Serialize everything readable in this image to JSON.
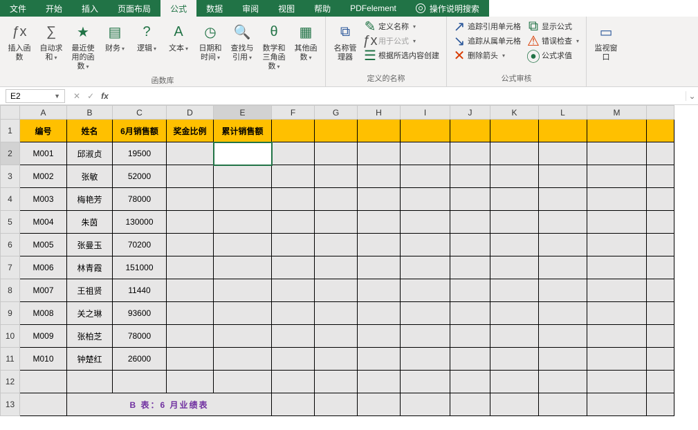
{
  "tabs": {
    "file": "文件",
    "home": "开始",
    "insert": "插入",
    "layout": "页面布局",
    "formulas": "公式",
    "data": "数据",
    "review": "审阅",
    "view": "视图",
    "help": "帮助",
    "pdf": "PDFelement",
    "tell": "操作说明搜索"
  },
  "ribbon": {
    "insert_fn": "插入函数",
    "autosum": "自动求和",
    "recent": "最近使用的函数",
    "financial": "财务",
    "logical": "逻辑",
    "text": "文本",
    "datetime": "日期和时间",
    "lookup": "查找与引用",
    "math": "数学和三角函数",
    "more": "其他函数",
    "lib_label": "函数库",
    "name_mgr": "名称管理器",
    "def_name": "定义名称",
    "use_formula": "用于公式",
    "from_sel": "根据所选内容创建",
    "names_label": "定义的名称",
    "trace_p": "追踪引用单元格",
    "trace_d": "追踪从属单元格",
    "remove_arrows": "删除箭头",
    "show_f": "显示公式",
    "err_check": "错误检查",
    "eval": "公式求值",
    "audit_label": "公式审核",
    "watch": "监视窗口"
  },
  "formula_bar": {
    "namebox": "E2",
    "fx": "fx",
    "value": ""
  },
  "icons": {
    "fx": "ƒx",
    "sigma": "∑",
    "star": "★",
    "book": "▤",
    "q": "?",
    "A": "A",
    "clock": "◷",
    "search": "🔍",
    "theta": "θ",
    "dots": "▦",
    "tag": "⧉",
    "define": "✎",
    "use": "ƒx",
    "create": "☰",
    "t_p": "↗",
    "t_d": "↘",
    "rem": "✕",
    "show": "⧉",
    "err": "⚠",
    "evalc": "⦿",
    "watch": "▭"
  },
  "columns": [
    "A",
    "B",
    "C",
    "D",
    "E",
    "F",
    "G",
    "H",
    "I",
    "J",
    "K",
    "L",
    "M",
    ""
  ],
  "row_nums": [
    "1",
    "2",
    "3",
    "4",
    "5",
    "6",
    "7",
    "8",
    "9",
    "10",
    "11",
    "12",
    "13"
  ],
  "chart_data": {
    "type": "table",
    "headers": [
      "编号",
      "姓名",
      "6月销售额",
      "奖金比例",
      "累计销售额"
    ],
    "rows": [
      [
        "M001",
        "邱淑贞",
        "19500",
        "",
        ""
      ],
      [
        "M002",
        "张敏",
        "52000",
        "",
        ""
      ],
      [
        "M003",
        "梅艳芳",
        "78000",
        "",
        ""
      ],
      [
        "M004",
        "朱茵",
        "130000",
        "",
        ""
      ],
      [
        "M005",
        "张曼玉",
        "70200",
        "",
        ""
      ],
      [
        "M006",
        "林青霞",
        "151000",
        "",
        ""
      ],
      [
        "M007",
        "王祖贤",
        "11440",
        "",
        ""
      ],
      [
        "M008",
        "关之琳",
        "93600",
        "",
        ""
      ],
      [
        "M009",
        "张柏芝",
        "78000",
        "",
        ""
      ],
      [
        "M010",
        "钟楚红",
        "26000",
        "",
        ""
      ]
    ],
    "title": "B 表：6 月业绩表"
  },
  "active_cell": "E2"
}
